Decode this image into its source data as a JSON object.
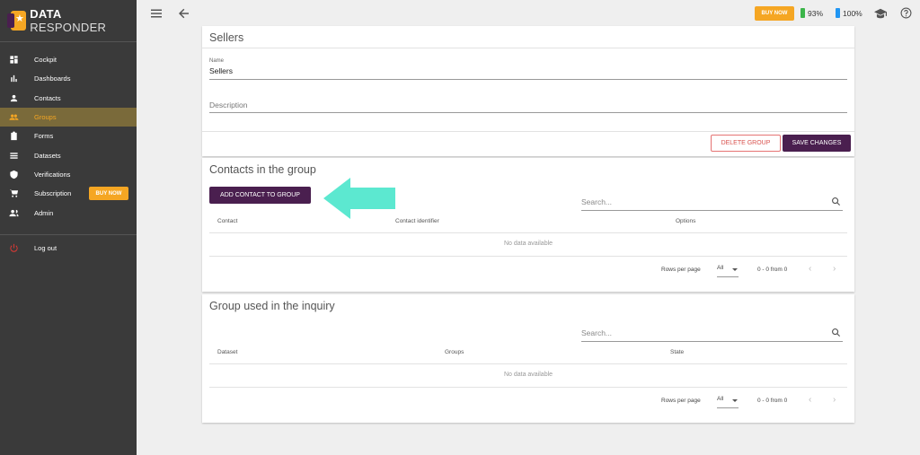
{
  "sidebar": {
    "logo": {
      "bold": "DATA",
      "light": "RESPONDER"
    },
    "items": [
      {
        "label": "Cockpit",
        "icon": "dashboard-icon"
      },
      {
        "label": "Dashboards",
        "icon": "bar-chart-icon"
      },
      {
        "label": "Contacts",
        "icon": "person-icon"
      },
      {
        "label": "Groups",
        "icon": "people-icon",
        "active": true
      },
      {
        "label": "Forms",
        "icon": "clipboard-icon"
      },
      {
        "label": "Datasets",
        "icon": "list-icon"
      },
      {
        "label": "Verifications",
        "icon": "shield-check-icon"
      },
      {
        "label": "Subscription",
        "icon": "cart-icon",
        "badge": "BUY NOW"
      },
      {
        "label": "Admin",
        "icon": "admin-people-icon"
      }
    ],
    "logout": {
      "label": "Log out",
      "icon": "power-icon"
    }
  },
  "topbar": {
    "buy_now": "BUY NOW",
    "battery1": "93%",
    "battery2": "100%",
    "icons": [
      "menu-icon",
      "back-arrow-icon",
      "graduation-cap-icon",
      "help-icon"
    ]
  },
  "group_card": {
    "title": "Sellers",
    "name_label": "Name",
    "name_value": "Sellers",
    "description_placeholder": "Description",
    "delete_label": "DELETE GROUP",
    "save_label": "SAVE CHANGES"
  },
  "contacts_card": {
    "title": "Contacts in the group",
    "add_label": "ADD CONTACT TO GROUP",
    "search_placeholder": "Search...",
    "columns": [
      "Contact",
      "Contact identifier",
      "Options"
    ],
    "empty": "No data available",
    "rows_per_page_label": "Rows per page",
    "rows_per_page_value": "All",
    "range": "0 - 0 from 0"
  },
  "inquiry_card": {
    "title": "Group used in the inquiry",
    "search_placeholder": "Search...",
    "columns": [
      "Dataset",
      "Groups",
      "State"
    ],
    "empty": "No data available",
    "rows_per_page_label": "Rows per page",
    "rows_per_page_value": "All",
    "range": "0 - 0 from 0"
  },
  "colors": {
    "sidebar_bg": "#3a3a3a",
    "accent": "#f5a623",
    "primary": "#4a1f4f",
    "annotation_arrow": "#5ce8d0"
  }
}
